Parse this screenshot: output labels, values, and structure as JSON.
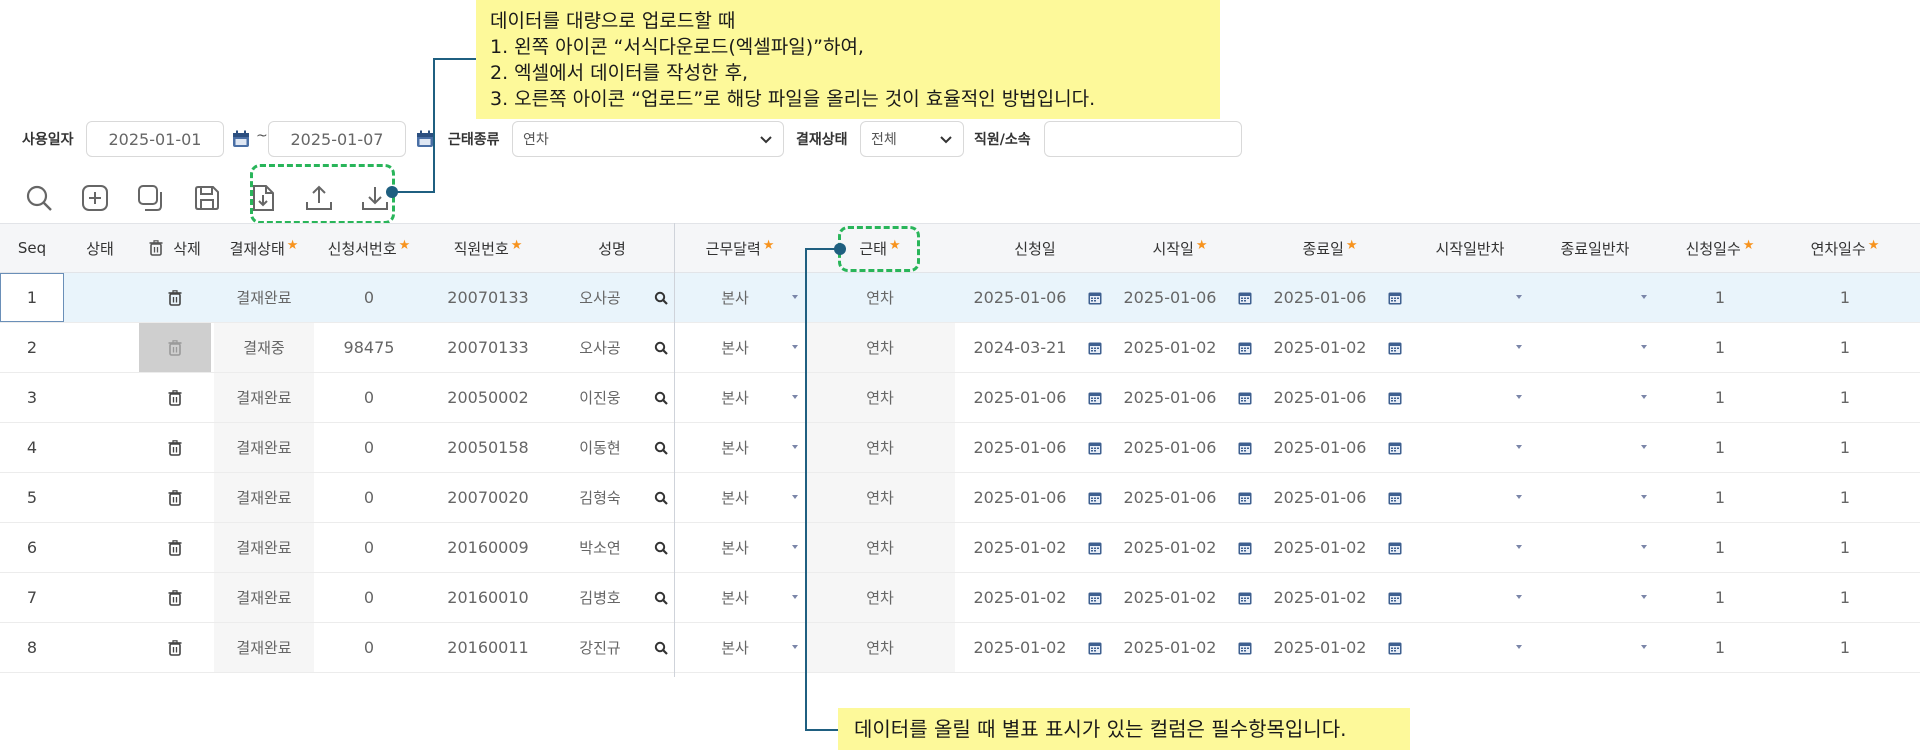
{
  "callout_top": {
    "title": "데이터를 대량으로 업로드할 때",
    "steps": [
      "1.   왼쪽 아이콘 “서식다운로드(엑셀파일)”하여,",
      "2.   엑셀에서 데이터를 작성한 후,",
      "3.   오른쪽 아이콘 “업로드”로 해당 파일을 올리는 것이 효율적인 방법입니다."
    ]
  },
  "callout_bottom": "데이터를 올릴 때 별표 표시가 있는 컬럼은 필수항목입니다.",
  "filters": {
    "use_date_label": "사용일자",
    "date_from": "2025-01-01",
    "date_sep": "~",
    "date_to": "2025-01-07",
    "attendance_type_label": "근태종류",
    "attendance_type_value": "연차",
    "approval_status_label": "결재상태",
    "approval_status_value": "전체",
    "employee_label": "직원/소속",
    "employee_value": ""
  },
  "toolbar": {
    "icons": [
      "search-icon",
      "add-icon",
      "copy-icon",
      "save-icon",
      "template-download-icon",
      "upload-icon",
      "download-icon"
    ]
  },
  "grid": {
    "columns": [
      {
        "label": "Seq",
        "required": false
      },
      {
        "label": "상태",
        "required": false
      },
      {
        "label": "삭제",
        "required": false
      },
      {
        "label": "결재상태",
        "required": true
      },
      {
        "label": "신청서번호",
        "required": true
      },
      {
        "label": "직원번호",
        "required": true
      },
      {
        "label": "성명",
        "required": false
      },
      {
        "label": "근무달력",
        "required": true
      },
      {
        "label": "근태",
        "required": true
      },
      {
        "label": "신청일",
        "required": false
      },
      {
        "label": "시작일",
        "required": true
      },
      {
        "label": "종료일",
        "required": true
      },
      {
        "label": "시작일반차",
        "required": false
      },
      {
        "label": "종료일반차",
        "required": false
      },
      {
        "label": "신청일수",
        "required": true
      },
      {
        "label": "연차일수",
        "required": true
      }
    ],
    "rows": [
      {
        "seq": "1",
        "status": "",
        "approval": "결재완료",
        "doc_no": "0",
        "emp_no": "20070133",
        "name": "오사공",
        "calendar": "본사",
        "attendance": "연차",
        "request_date": "2025-01-06",
        "start_date": "2025-01-06",
        "end_date": "2025-01-06",
        "start_half": "",
        "end_half": "",
        "req_days": "1",
        "annual_days": "1",
        "selected": true,
        "delete_disabled": false
      },
      {
        "seq": "2",
        "status": "",
        "approval": "결재중",
        "doc_no": "98475",
        "emp_no": "20070133",
        "name": "오사공",
        "calendar": "본사",
        "attendance": "연차",
        "request_date": "2024-03-21",
        "start_date": "2025-01-02",
        "end_date": "2025-01-02",
        "start_half": "",
        "end_half": "",
        "req_days": "1",
        "annual_days": "1",
        "selected": false,
        "delete_disabled": true
      },
      {
        "seq": "3",
        "status": "",
        "approval": "결재완료",
        "doc_no": "0",
        "emp_no": "20050002",
        "name": "이진웅",
        "calendar": "본사",
        "attendance": "연차",
        "request_date": "2025-01-06",
        "start_date": "2025-01-06",
        "end_date": "2025-01-06",
        "start_half": "",
        "end_half": "",
        "req_days": "1",
        "annual_days": "1",
        "selected": false,
        "delete_disabled": false
      },
      {
        "seq": "4",
        "status": "",
        "approval": "결재완료",
        "doc_no": "0",
        "emp_no": "20050158",
        "name": "이동현",
        "calendar": "본사",
        "attendance": "연차",
        "request_date": "2025-01-06",
        "start_date": "2025-01-06",
        "end_date": "2025-01-06",
        "start_half": "",
        "end_half": "",
        "req_days": "1",
        "annual_days": "1",
        "selected": false,
        "delete_disabled": false
      },
      {
        "seq": "5",
        "status": "",
        "approval": "결재완료",
        "doc_no": "0",
        "emp_no": "20070020",
        "name": "김형숙",
        "calendar": "본사",
        "attendance": "연차",
        "request_date": "2025-01-06",
        "start_date": "2025-01-06",
        "end_date": "2025-01-06",
        "start_half": "",
        "end_half": "",
        "req_days": "1",
        "annual_days": "1",
        "selected": false,
        "delete_disabled": false
      },
      {
        "seq": "6",
        "status": "",
        "approval": "결재완료",
        "doc_no": "0",
        "emp_no": "20160009",
        "name": "박소연",
        "calendar": "본사",
        "attendance": "연차",
        "request_date": "2025-01-02",
        "start_date": "2025-01-02",
        "end_date": "2025-01-02",
        "start_half": "",
        "end_half": "",
        "req_days": "1",
        "annual_days": "1",
        "selected": false,
        "delete_disabled": false
      },
      {
        "seq": "7",
        "status": "",
        "approval": "결재완료",
        "doc_no": "0",
        "emp_no": "20160010",
        "name": "김병호",
        "calendar": "본사",
        "attendance": "연차",
        "request_date": "2025-01-02",
        "start_date": "2025-01-02",
        "end_date": "2025-01-02",
        "start_half": "",
        "end_half": "",
        "req_days": "1",
        "annual_days": "1",
        "selected": false,
        "delete_disabled": false
      },
      {
        "seq": "8",
        "status": "",
        "approval": "결재완료",
        "doc_no": "0",
        "emp_no": "20160011",
        "name": "강진규",
        "calendar": "본사",
        "attendance": "연차",
        "request_date": "2025-01-02",
        "start_date": "2025-01-02",
        "end_date": "2025-01-02",
        "start_half": "",
        "end_half": "",
        "req_days": "1",
        "annual_days": "1",
        "selected": false,
        "delete_disabled": false
      }
    ]
  },
  "colors": {
    "callout_bg": "#fdf99a",
    "highlight_border": "#29b55a",
    "connector": "#1f5f80",
    "required_star": "#f7931e",
    "selected_row_bg": "#e9f4fb"
  }
}
